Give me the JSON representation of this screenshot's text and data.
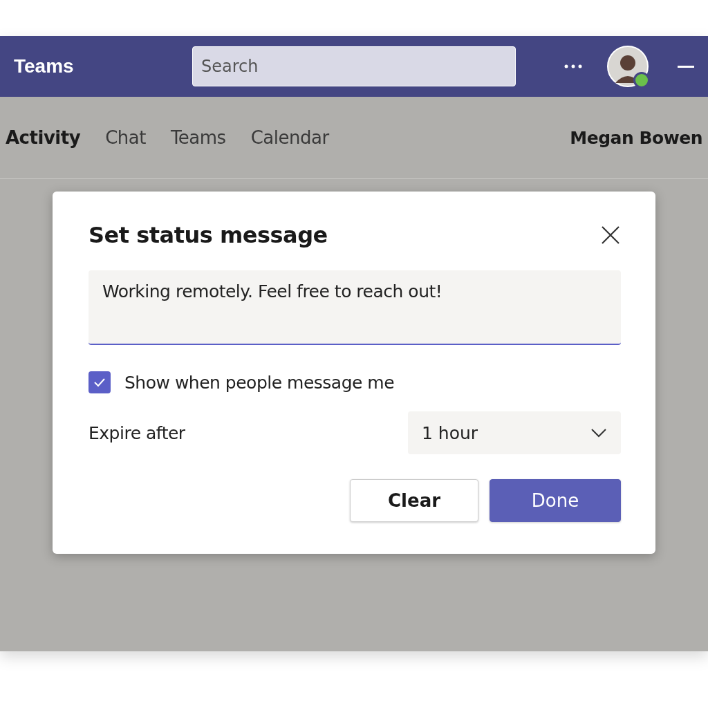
{
  "app": {
    "name": "Teams"
  },
  "search": {
    "placeholder": "Search"
  },
  "nav_tabs": [
    {
      "label": "Activity",
      "selected": true
    },
    {
      "label": "Chat",
      "selected": false
    },
    {
      "label": "Teams",
      "selected": false
    },
    {
      "label": "Calendar",
      "selected": false
    }
  ],
  "user_name": "Megan Bowen",
  "dialog": {
    "title": "Set status message",
    "message": "Working remotely. Feel free to reach out!",
    "show_when_messaged": {
      "label": "Show when people message me",
      "checked": true
    },
    "expire": {
      "label": "Expire after",
      "value": "1 hour"
    },
    "buttons": [
      {
        "label": "Clear",
        "kind": "secondary"
      },
      {
        "label": "Done",
        "kind": "primary"
      }
    ]
  }
}
